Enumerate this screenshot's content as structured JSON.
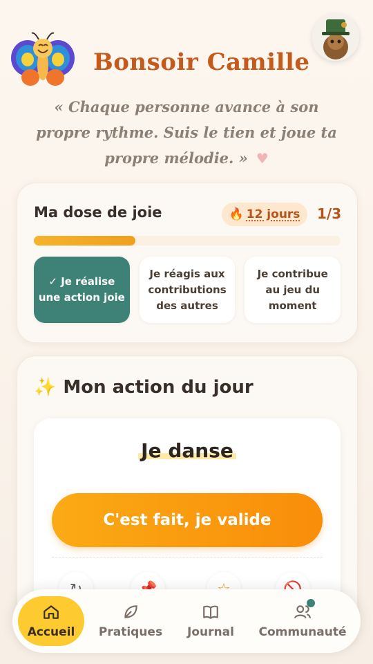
{
  "header": {
    "greeting": "Bonsoir Camille",
    "quote": "« Chaque personne avance à son propre rythme. Suis le tien et joue ta propre mélodie. »"
  },
  "dose": {
    "title": "Ma dose de joie",
    "streak_label": "12 jours",
    "count": "1/3",
    "progress_fraction": 0.33,
    "steps": [
      {
        "label": "✓ Je réalise une action joie",
        "active": true
      },
      {
        "label": "Je réagis aux contributions des autres",
        "active": false
      },
      {
        "label": "Je contribue au jeu du moment",
        "active": false
      }
    ]
  },
  "action": {
    "title": "Mon action du jour",
    "name": "Je danse",
    "validate_label": "C'est fait, je valide"
  },
  "nav": {
    "items": [
      {
        "label": "Accueil"
      },
      {
        "label": "Pratiques"
      },
      {
        "label": "Journal"
      },
      {
        "label": "Communauté"
      }
    ]
  },
  "colors": {
    "accent": "#c45a1c",
    "teal": "#3e8277",
    "orange": "#fbaa14",
    "yellow": "#fdcb2f"
  }
}
